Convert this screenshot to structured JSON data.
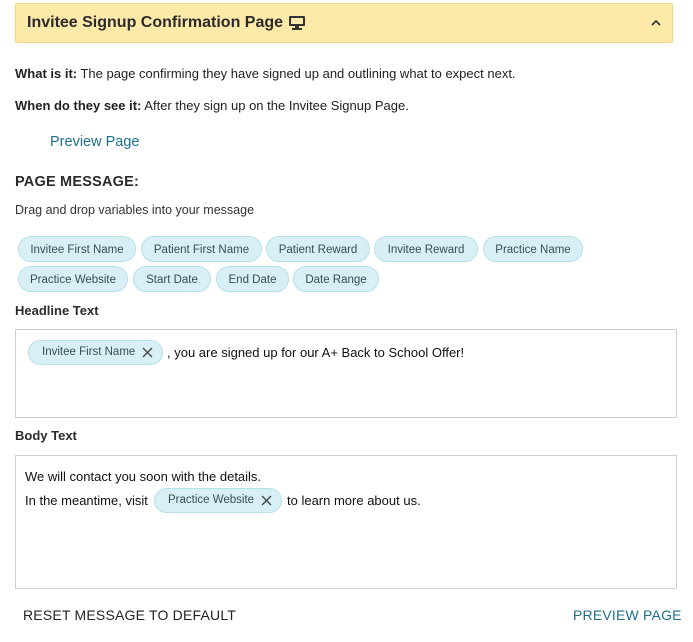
{
  "header": {
    "title": "Invitee Signup Confirmation Page",
    "monitor_icon": "monitor-icon",
    "collapse_icon": "chevron-up-icon"
  },
  "info": {
    "what_label": "What is it:",
    "what_text": " The page confirming they have signed up and outlining what to expect next.",
    "when_label": "When do they see it:",
    "when_text": " After they sign up on the Invitee Signup Page."
  },
  "preview_link": "Preview Page",
  "page_message": {
    "title": "PAGE MESSAGE:",
    "hint": "Drag and drop variables into your message",
    "variables": [
      "Invitee First Name",
      "Patient First Name",
      "Patient Reward",
      "Invitee Reward",
      "Practice Name",
      "Practice Website",
      "Start Date",
      "End Date",
      "Date Range"
    ]
  },
  "headline": {
    "label": "Headline Text",
    "chip": "Invitee First Name",
    "text": ", you are signed up for our A+ Back to School Offer!"
  },
  "body": {
    "label": "Body Text",
    "line1": "We will contact you soon with the details.",
    "line2_before": "In the meantime, visit",
    "chip": "Practice Website",
    "line2_after": "to learn more about us."
  },
  "footer": {
    "reset_label": "RESET MESSAGE TO DEFAULT",
    "preview_label": "PREVIEW PAGE"
  },
  "colors": {
    "header_bg": "#fde9a8",
    "chip_bg": "#d8f0f5",
    "link": "#1f6f8b"
  }
}
